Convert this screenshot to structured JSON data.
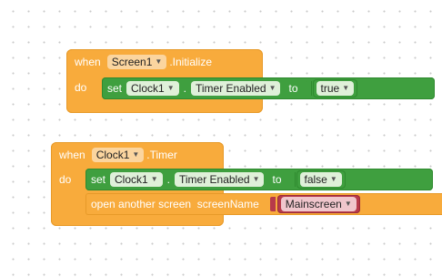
{
  "block1": {
    "when_label": "when",
    "component": "Screen1",
    "event": ".Initialize",
    "do_label": "do",
    "statement": {
      "set_label": "set",
      "component": "Clock1",
      "dot": ".",
      "property": "Timer Enabled",
      "to_label": "to",
      "value": "true"
    }
  },
  "block2": {
    "when_label": "when",
    "component": "Clock1",
    "event": ".Timer",
    "do_label": "do",
    "statement1": {
      "set_label": "set",
      "component": "Clock1",
      "dot": ".",
      "property": "Timer Enabled",
      "to_label": "to",
      "value": "false"
    },
    "statement2": {
      "action_label": "open another screen  screenName",
      "value": "Mainscreen"
    }
  },
  "colors": {
    "event_block": "#f8ab3c",
    "statement_block": "#3f9f3f",
    "text_block": "#b73a4a"
  }
}
